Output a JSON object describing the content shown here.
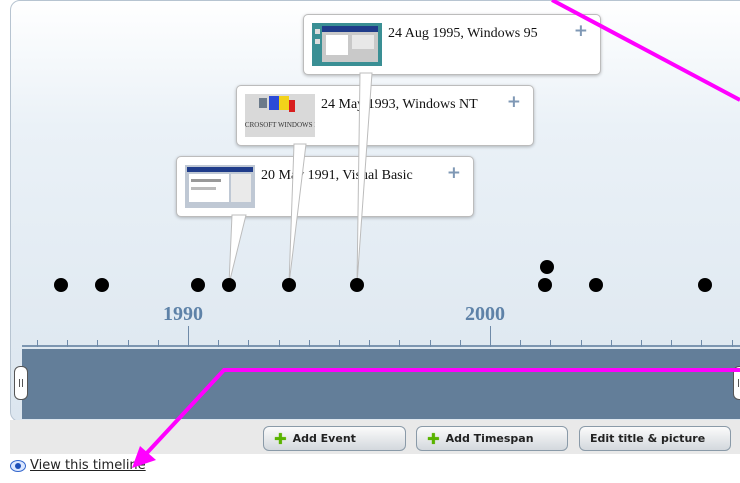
{
  "timeline": {
    "events": [
      {
        "date_title": "20 May 1991, Visual Basic",
        "plus": "+"
      },
      {
        "date_title": "24 May 1993, Windows NT",
        "plus": "+"
      },
      {
        "date_title": "24 Aug 1995, Windows 95",
        "plus": "+"
      }
    ],
    "years": [
      "1990",
      "2000"
    ],
    "thumb_logo_text": "MICROSOFT WINDOWS NT"
  },
  "toolbar": {
    "add_event": "Add Event",
    "add_timespan": "Add Timespan",
    "edit_title": "Edit title & picture"
  },
  "footer": {
    "view_timeline": "View this timeline"
  },
  "colors": {
    "annotation_arrow": "#ff00ff",
    "year_label": "#5e82a8",
    "scrollbar": "#637e99"
  },
  "icons": [
    "plus-icon",
    "green-plus-icon",
    "eye-icon"
  ]
}
